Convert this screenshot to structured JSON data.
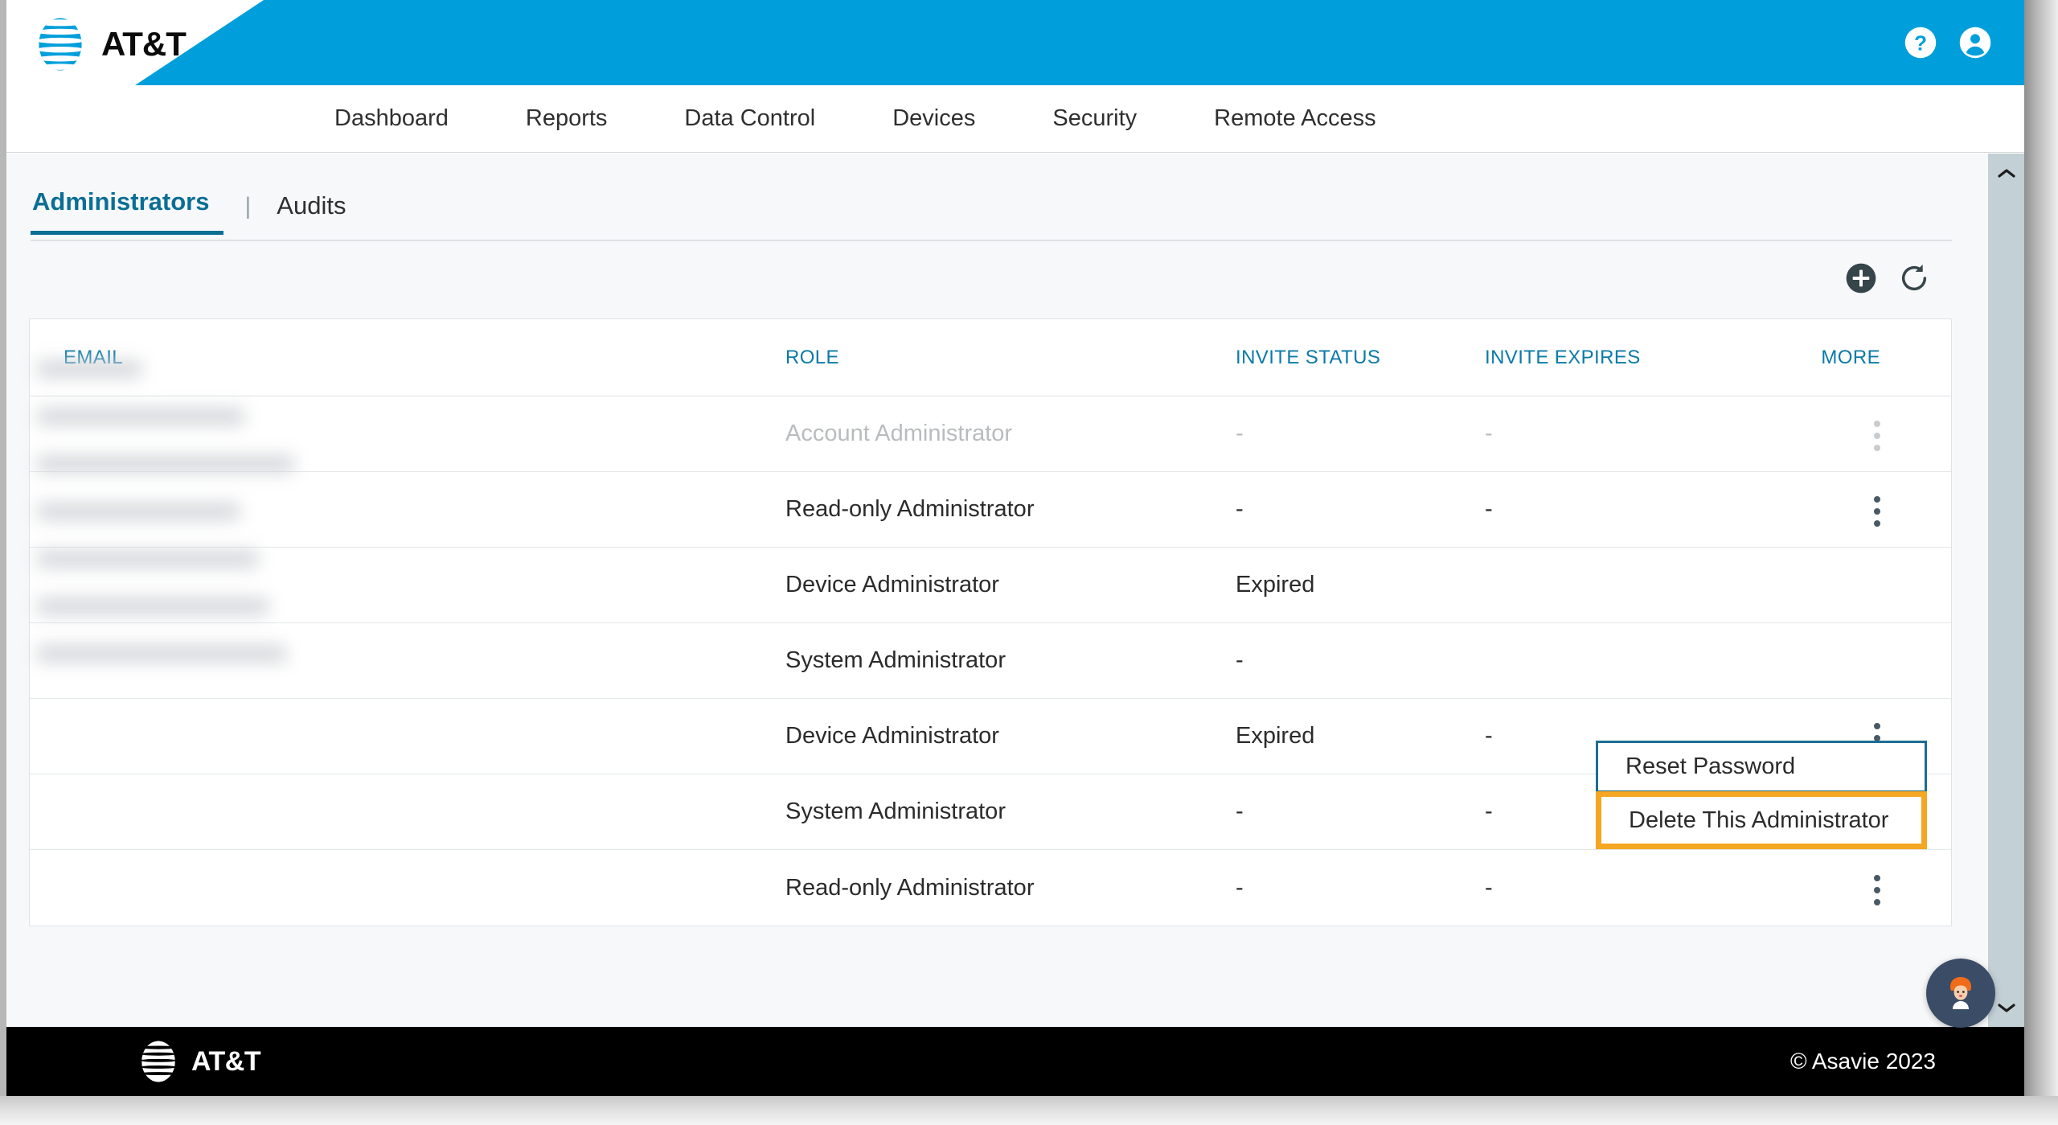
{
  "brand": {
    "name": "AT&T",
    "header_logo_icon": "att-globe-icon",
    "footer_logo_icon": "att-globe-icon",
    "accent_blue": "#009fdb",
    "link_blue": "#0b7aa8",
    "tab_active_blue": "#0b6e94",
    "highlight_orange": "#f5a623",
    "menu_border_blue": "#1b6e91"
  },
  "topbar": {
    "help_icon": "help-circle-icon",
    "account_icon": "account-circle-icon"
  },
  "nav": {
    "items": [
      {
        "label": "Dashboard"
      },
      {
        "label": "Reports"
      },
      {
        "label": "Data Control"
      },
      {
        "label": "Devices"
      },
      {
        "label": "Security"
      },
      {
        "label": "Remote Access"
      }
    ]
  },
  "tabs": {
    "separator": "|",
    "items": [
      {
        "label": "Administrators",
        "active": true
      },
      {
        "label": "Audits",
        "active": false
      }
    ]
  },
  "toolbar": {
    "add_icon": "plus-circle-icon",
    "add_label": "Add Administrator",
    "refresh_icon": "refresh-icon",
    "refresh_label": "Refresh"
  },
  "table": {
    "columns": [
      {
        "key": "email",
        "label": "EMAIL"
      },
      {
        "key": "role",
        "label": "ROLE"
      },
      {
        "key": "invite_status",
        "label": "INVITE STATUS"
      },
      {
        "key": "invite_expires",
        "label": "INVITE EXPIRES"
      },
      {
        "key": "more",
        "label": "MORE"
      }
    ],
    "rows": [
      {
        "email": "",
        "email_redacted": true,
        "role": "Account Administrator",
        "invite_status": "-",
        "invite_expires": "-",
        "more_icon": "kebab-menu-icon",
        "muted": true
      },
      {
        "email": "",
        "email_redacted": true,
        "role": "Read-only Administrator",
        "invite_status": "-",
        "invite_expires": "-",
        "more_icon": "kebab-menu-icon",
        "muted": false
      },
      {
        "email": "",
        "email_redacted": true,
        "role": "Device Administrator",
        "invite_status": "Expired",
        "invite_expires": "",
        "more_icon": "kebab-menu-icon",
        "muted": false
      },
      {
        "email": "",
        "email_redacted": true,
        "role": "System Administrator",
        "invite_status": "-",
        "invite_expires": "",
        "more_icon": "kebab-menu-icon",
        "muted": false
      },
      {
        "email": "",
        "email_redacted": true,
        "role": "Device Administrator",
        "invite_status": "Expired",
        "invite_expires": "-",
        "more_icon": "kebab-menu-icon",
        "muted": false
      },
      {
        "email": "",
        "email_redacted": true,
        "role": "System Administrator",
        "invite_status": "-",
        "invite_expires": "-",
        "more_icon": "kebab-menu-icon",
        "muted": false
      },
      {
        "email": "",
        "email_redacted": true,
        "role": "Read-only Administrator",
        "invite_status": "-",
        "invite_expires": "-",
        "more_icon": "kebab-menu-icon",
        "muted": false
      }
    ]
  },
  "row_menu": {
    "open": true,
    "items": [
      {
        "label": "Reset Password",
        "state": "focused"
      },
      {
        "label": "Delete This Administrator",
        "state": "highlighted"
      }
    ]
  },
  "footer": {
    "copyright": "© Asavie 2023"
  },
  "chat": {
    "avatar_icon": "chat-agent-avatar-icon",
    "label": "Chat"
  },
  "scrollbar": {
    "up_icon": "chevron-up-icon",
    "down_icon": "chevron-down-icon"
  }
}
